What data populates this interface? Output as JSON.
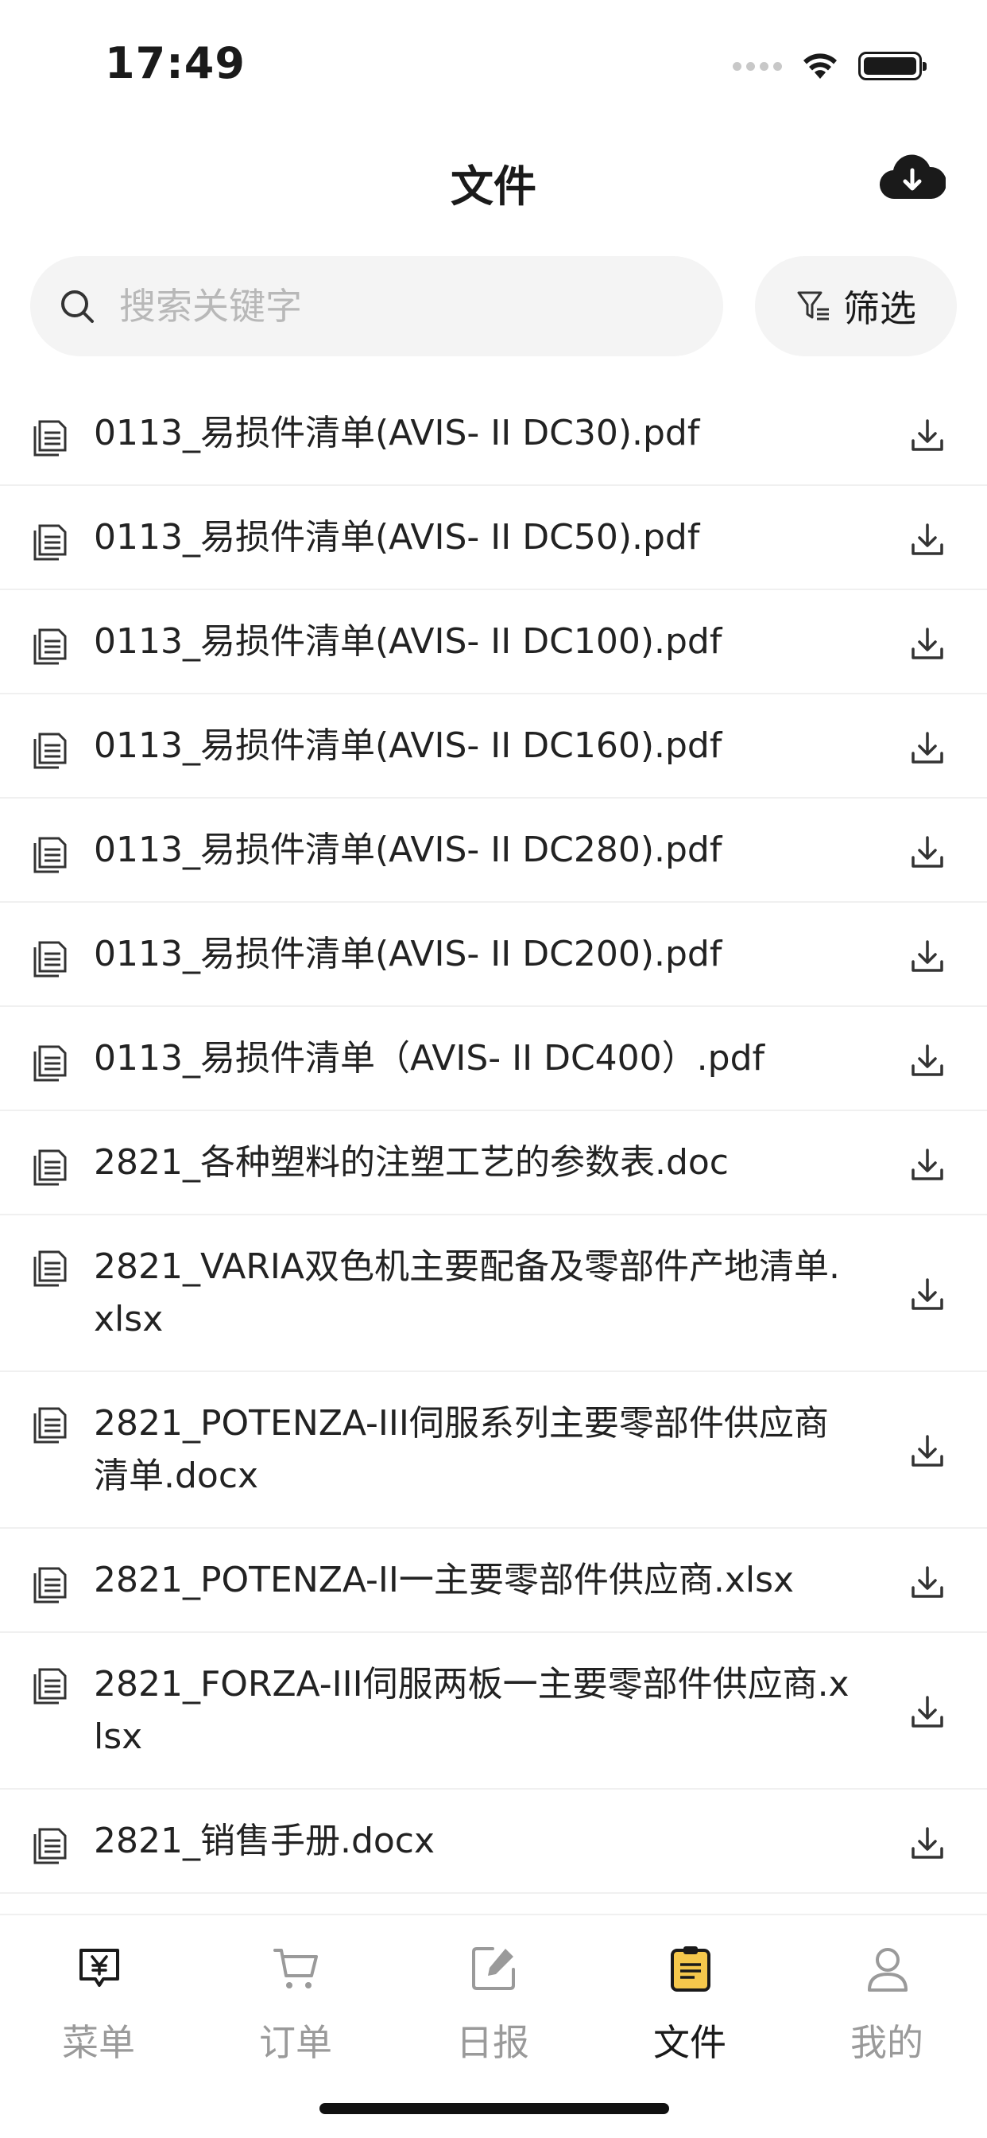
{
  "status_bar": {
    "time": "17:49"
  },
  "header": {
    "title": "文件"
  },
  "search": {
    "placeholder": "搜索关键字"
  },
  "filter": {
    "label": "筛选"
  },
  "files": [
    {
      "name": "0113_易损件清单(AVIS- II DC30).pdf",
      "lines": 1
    },
    {
      "name": "0113_易损件清单(AVIS- II DC50).pdf",
      "lines": 1
    },
    {
      "name": "0113_易损件清单(AVIS- II DC100).pdf",
      "lines": 1
    },
    {
      "name": "0113_易损件清单(AVIS- II DC160).pdf",
      "lines": 1
    },
    {
      "name": "0113_易损件清单(AVIS- II DC280).pdf",
      "lines": 1
    },
    {
      "name": "0113_易损件清单(AVIS- II DC200).pdf",
      "lines": 1
    },
    {
      "name": "0113_易损件清单（AVIS- II DC400）.pdf",
      "lines": 1
    },
    {
      "name": "2821_各种塑料的注塑工艺的参数表.doc",
      "lines": 1
    },
    {
      "name": "2821_VARIA双色机主要配备及零部件产地清单.xlsx",
      "lines": 2
    },
    {
      "name": "2821_POTENZA-III伺服系列主要零部件供应商清单.docx",
      "lines": 2
    },
    {
      "name": "2821_POTENZA-II一主要零部件供应商.xlsx",
      "lines": 1
    },
    {
      "name": "2821_FORZA-III伺服两板一主要零部件供应商.xlsx",
      "lines": 2
    },
    {
      "name": "2821_销售手册.docx",
      "lines": 1
    }
  ],
  "tabs": [
    {
      "label": "菜单",
      "icon": "menu-yen-icon",
      "active": false
    },
    {
      "label": "订单",
      "icon": "cart-icon",
      "active": false
    },
    {
      "label": "日报",
      "icon": "edit-report-icon",
      "active": false
    },
    {
      "label": "文件",
      "icon": "file-icon",
      "active": true
    },
    {
      "label": "我的",
      "icon": "person-icon",
      "active": false
    }
  ],
  "colors": {
    "active_tab_icon": "#f5c84c",
    "inactive_tab": "#9a9a9a",
    "search_bg": "#f4f4f4"
  }
}
